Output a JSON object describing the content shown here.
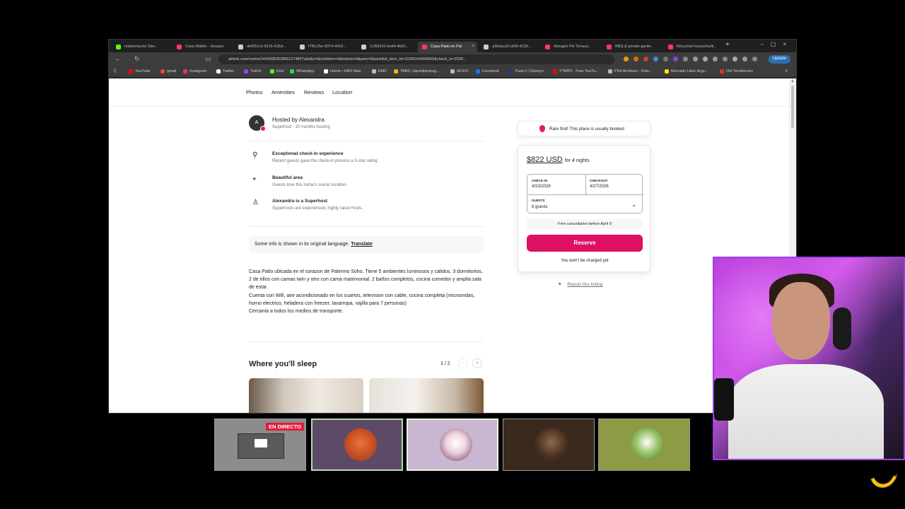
{
  "browser": {
    "tabs": [
      {
        "label": "mistermacho Stre..",
        "color": "#53fc18"
      },
      {
        "label": "Casa Maldin - Houses",
        "color": "#ff385c"
      },
      {
        "label": "def551c0-5616-416d-..",
        "color": "#cccccc"
      },
      {
        "label": "f7f5c25e-6974-4410-..",
        "color": "#cccccc"
      },
      {
        "label": "1cf542c5-6ed4-4b01-..",
        "color": "#cccccc"
      },
      {
        "label": "Casa Patio en Pal",
        "color": "#ff385c"
      },
      {
        "label": "a36dacd3-af09-4239-..",
        "color": "#cccccc"
      },
      {
        "label": "Almagro PH Terrace..",
        "color": "#ff385c"
      },
      {
        "label": "BBQ & private garde..",
        "color": "#ff385c"
      },
      {
        "label": "Recycled house/multi..",
        "color": "#ff385c"
      }
    ],
    "url": "airbnb.com/rooms/1434096252866127485?adults=6&children=0&infants=0&pets=0&wishlist_item_id=11006144409969&check_in=2026-..",
    "update_label": "Update",
    "bookmarks": [
      {
        "label": "YouTube",
        "color": "#ff0000"
      },
      {
        "label": "gmail",
        "color": "#ea4335"
      },
      {
        "label": "Instagram",
        "color": "#e1306c"
      },
      {
        "label": "Twitter",
        "color": "#ffffff"
      },
      {
        "label": "Twitch",
        "color": "#9146ff"
      },
      {
        "label": "Kick",
        "color": "#53fc18"
      },
      {
        "label": "WhatsApp",
        "color": "#25d366"
      },
      {
        "label": "Home • HBO Max",
        "color": "#ffffff"
      },
      {
        "label": "EMC",
        "color": "#bbbbbb"
      },
      {
        "label": "TABS | danieljamesg...",
        "color": "#e0c000"
      },
      {
        "label": "AC/DC",
        "color": "#bbbbbb"
      },
      {
        "label": "Facebook",
        "color": "#1877f2"
      },
      {
        "label": "Para ti | Disney+",
        "color": "#1a3c8c"
      },
      {
        "label": "YTMP3 - Free YouTu...",
        "color": "#ff0000"
      },
      {
        "label": "PS4 Archives - Dow...",
        "color": "#bbbbbb"
      },
      {
        "label": "Mercado Libre Arge...",
        "color": "#ffe600"
      },
      {
        "label": "Old Tendencies",
        "color": "#e83030"
      }
    ]
  },
  "subnav": {
    "items": [
      "Photos",
      "Amenities",
      "Reviews",
      "Location"
    ]
  },
  "host": {
    "avatar_initial": "A",
    "name": "Hosted by Alexandra",
    "subtitle": "Superhost · 10 months hosting"
  },
  "features": [
    {
      "icon": "key-icon",
      "glyph": "⚲",
      "title": "Exceptional check-in experience",
      "subtitle": "Recent guests gave the check-in process a 5-star rating."
    },
    {
      "icon": "location-pin-icon",
      "glyph": "⌖",
      "title": "Beautiful area",
      "subtitle": "Guests love this home's scenic location."
    },
    {
      "icon": "medal-icon",
      "glyph": "♙",
      "title": "Alexandra is a Superhost",
      "subtitle": "Superhosts are experienced, highly rated Hosts."
    }
  ],
  "translate": {
    "text": "Some info is shown in its original language.",
    "link": "Translate"
  },
  "description": [
    "Casa Patio ubicada en el corazon de Palermo Soho. Tiene 5 ambientes luminosos y calidos. 3 dormitorios, 2 de ellos con camas twin y otro con cama matrimonial. 2 baños completos, cocina comedor y amplia sala de estar.",
    "Cuenta con Wifi, aire acondicionado en los cuartos, television con cable, cocina completa (microondas, horno electrico, heladera con freezer, lavarropa, vajilla para 7 personas)",
    "Cercania a todos los medios de transporte."
  ],
  "sleep": {
    "title": "Where you'll sleep",
    "pager": "1 / 2",
    "prev": "‹",
    "next": "›"
  },
  "rare": {
    "text": "Rare find! This place is usually booked"
  },
  "booking": {
    "price": "$822 USD",
    "price_for": "for 4 nights",
    "checkin_label": "CHECK-IN",
    "checkin_value": "4/23/2026",
    "checkout_label": "CHECKOUT",
    "checkout_value": "4/27/2026",
    "guests_label": "GUESTS",
    "guests_value": "6 guests",
    "cancel_text": "Free cancellation before April 9",
    "reserve_label": "Reserve",
    "not_charged": "You won't be charged yet",
    "accent": "#dd1062"
  },
  "report": {
    "text": "Report this listing"
  },
  "stream": {
    "live_badge": "EN DIRECTO"
  }
}
